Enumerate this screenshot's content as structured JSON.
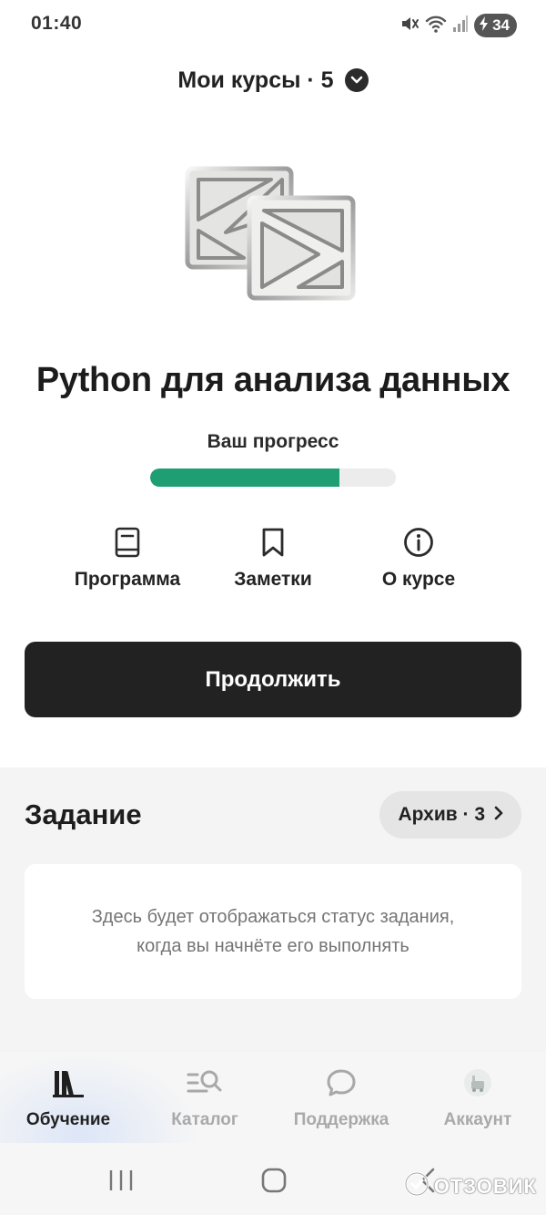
{
  "status_bar": {
    "time": "01:40",
    "battery": "34"
  },
  "header": {
    "title": "Мои курсы · 5"
  },
  "course": {
    "title": "Python для анализа данных",
    "progress_label": "Ваш прогресс",
    "progress_fraction": 0.77
  },
  "actions": {
    "program": "Программа",
    "notes": "Заметки",
    "about": "О курсе"
  },
  "continue_button": "Продолжить",
  "task": {
    "title": "Задание",
    "archive_label": "Архив · 3",
    "empty_text": "Здесь будет отображаться статус задания, когда вы начнёте его выполнять"
  },
  "tabs": [
    {
      "label": "Обучение",
      "icon": "books-icon",
      "active": true
    },
    {
      "label": "Каталог",
      "icon": "catalog-search-icon",
      "active": false
    },
    {
      "label": "Поддержка",
      "icon": "chat-bubble-icon",
      "active": false
    },
    {
      "label": "Аккаунт",
      "icon": "avatar-icon",
      "active": false
    }
  ],
  "watermark": "ОТЗОВИК",
  "colors": {
    "accent": "#1f9e73",
    "button": "#222222",
    "section_bg": "#f4f4f4"
  }
}
